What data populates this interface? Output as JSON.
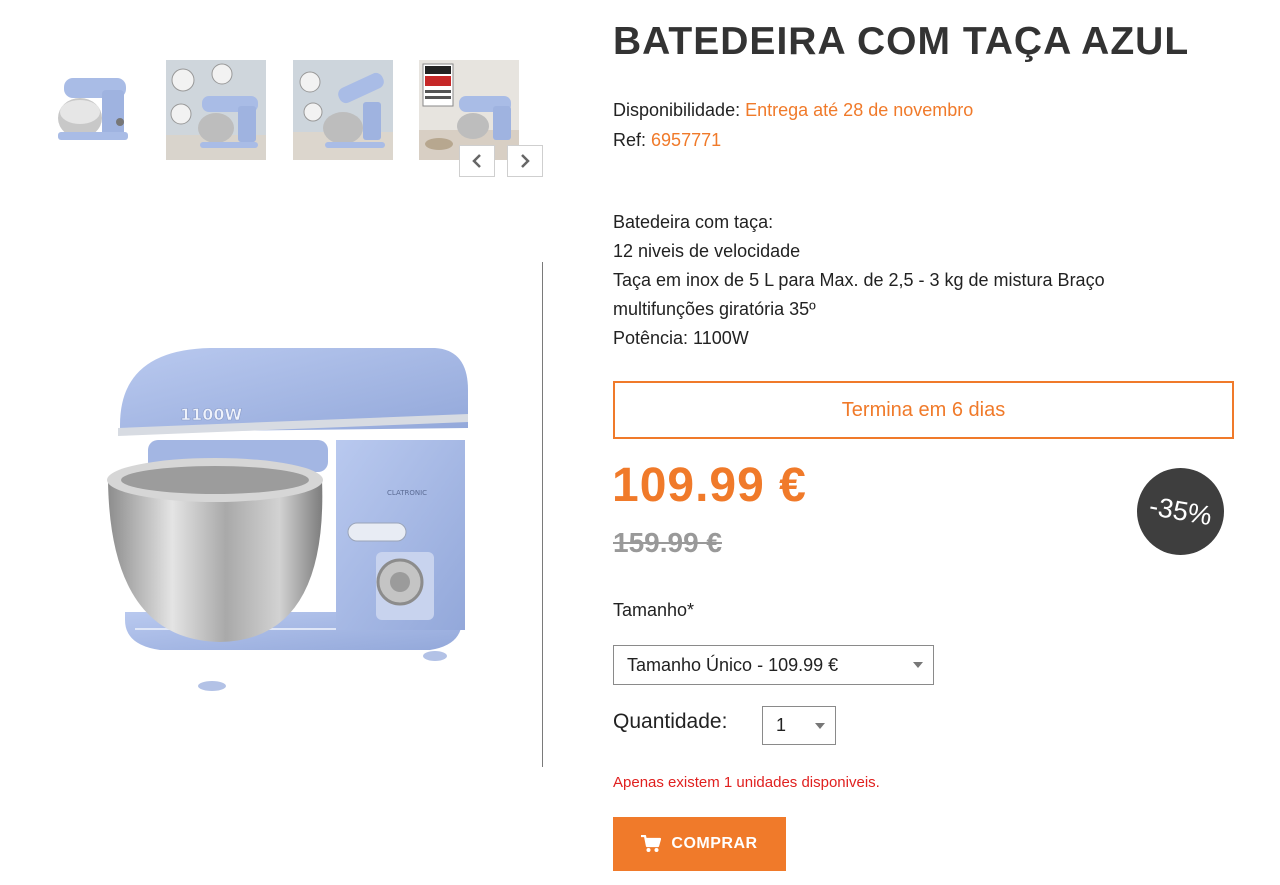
{
  "product": {
    "title": "BATEDEIRA COM TAÇA AZUL",
    "availability_label": "Disponibilidade:",
    "availability_value": "Entrega até 28 de novembro",
    "ref_label": "Ref:",
    "ref_value": "6957771",
    "description": [
      "Batedeira com taça:",
      "12 niveis de velocidade",
      "Taça em inox de 5 L para Max. de 2,5 - 3 kg de mistura Braço",
      "multifunções giratória 35º",
      "Potência: 1100W"
    ],
    "image_model_text": "1100W",
    "brand_text": "CLATRONIC"
  },
  "offer": {
    "countdown": "Termina em 6 dias",
    "price": "109.99 €",
    "old_price": "159.99 €",
    "discount": "-35%"
  },
  "size": {
    "label": "Tamanho*",
    "selected": "Tamanho Único - 109.99 €"
  },
  "quantity": {
    "label": "Quantidade:",
    "selected": "1"
  },
  "stock_message": "Apenas existem 1 unidades disponiveis.",
  "buy_button": {
    "label": "COMPRAR",
    "icon": "cart-icon"
  },
  "thumbnails": {
    "count": 4,
    "nav_icons": [
      "chevron-left-icon",
      "chevron-right-icon"
    ]
  },
  "colors": {
    "accent": "#f07a2a",
    "product_blue": "#a9bce6",
    "discount_badge": "#3e3e3e",
    "error": "#e0201f"
  }
}
